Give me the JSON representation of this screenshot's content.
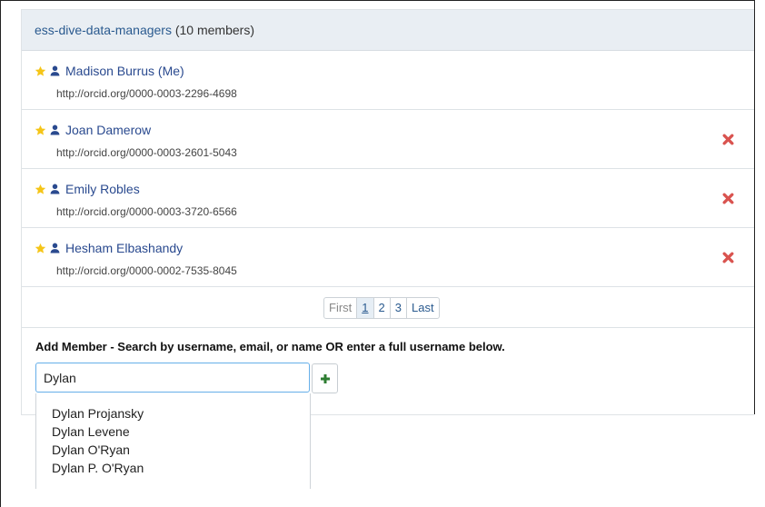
{
  "group": {
    "name": "ess-dive-data-managers",
    "member_count": "(10 members)"
  },
  "members": [
    {
      "name": "Madison Burrus (Me)",
      "orcid": "http://orcid.org/0000-0003-2296-4698",
      "removable": false
    },
    {
      "name": "Joan Damerow",
      "orcid": "http://orcid.org/0000-0003-2601-5043",
      "removable": true
    },
    {
      "name": "Emily Robles",
      "orcid": "http://orcid.org/0000-0003-3720-6566",
      "removable": true
    },
    {
      "name": "Hesham Elbashandy",
      "orcid": "http://orcid.org/0000-0002-7535-8045",
      "removable": true
    }
  ],
  "pagination": {
    "first": "First",
    "pages": [
      "1",
      "2",
      "3"
    ],
    "current_page": "1",
    "last": "Last"
  },
  "add_member": {
    "title": "Add Member - Search by username, email, or name OR enter a full username below.",
    "search_value": "Dylan"
  },
  "suggestions": [
    "Dylan Projansky",
    "Dylan Levene",
    "Dylan O'Ryan",
    "Dylan P. O'Ryan"
  ],
  "colors": {
    "link": "#2a5a8f",
    "star": "#f5c518",
    "remove": "#d9534f",
    "add": "#2e7d32",
    "header_bg": "#e9eef3"
  },
  "icons": {
    "star": "star-icon",
    "user": "user-icon",
    "remove": "remove-icon",
    "add": "plus-icon"
  }
}
